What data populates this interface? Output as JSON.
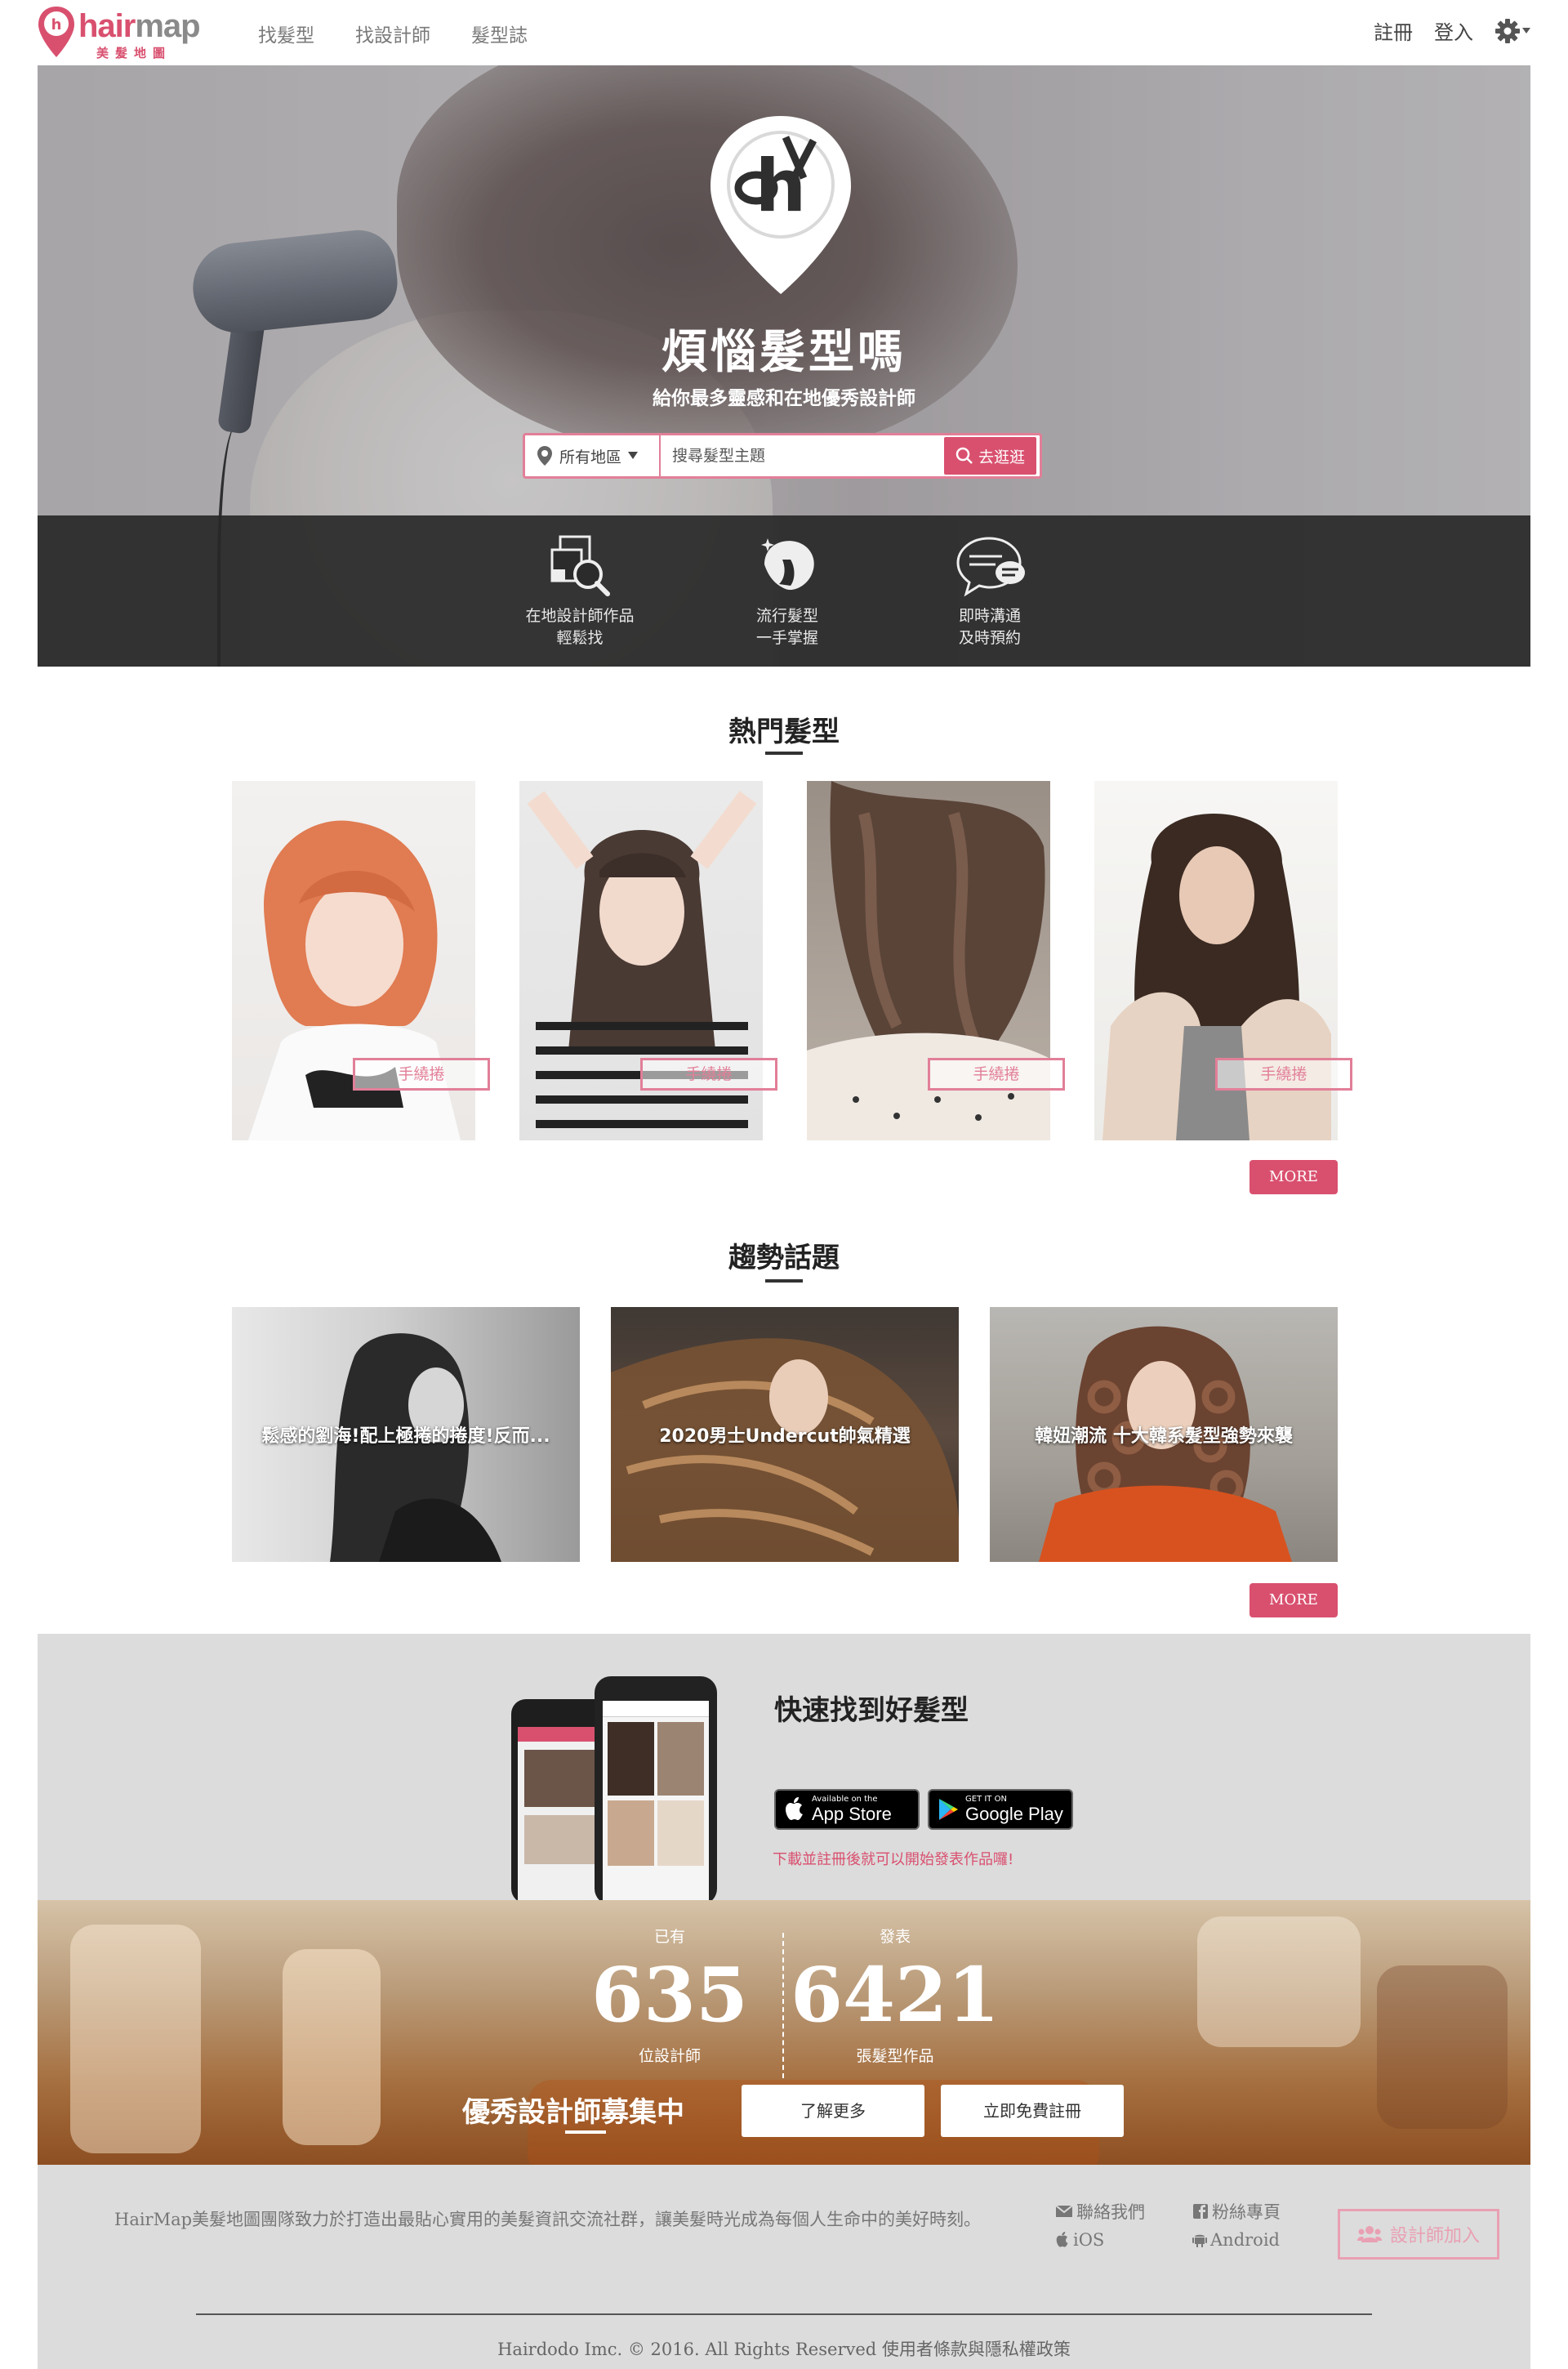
{
  "brand": {
    "name_part1": "hair",
    "name_part2": "map",
    "subtitle": "美髮地圖",
    "color": "#d9506f"
  },
  "nav": {
    "links": [
      "找髮型",
      "找設計師",
      "髮型誌"
    ],
    "register": "註冊",
    "login": "登入",
    "settings_icon": "gear-icon"
  },
  "hero": {
    "title": "煩惱髮型嗎",
    "subtitle": "給你最多靈感和在地優秀設計師",
    "search": {
      "region_label": "所有地區",
      "placeholder": "搜尋髮型主題",
      "button": "去逛逛"
    },
    "features": [
      {
        "icon": "search-works-icon",
        "line1": "在地設計師作品",
        "line2": "輕鬆找"
      },
      {
        "icon": "hairstyle-head-icon",
        "line1": "流行髮型",
        "line2": "一手掌握"
      },
      {
        "icon": "chat-bubble-icon",
        "line1": "即時溝通",
        "line2": "及時預約"
      }
    ]
  },
  "hot_styles": {
    "title": "熱門髮型",
    "items": [
      {
        "tag": "手繞捲"
      },
      {
        "tag": "手繞捲"
      },
      {
        "tag": "手繞捲"
      },
      {
        "tag": "手繞捲"
      }
    ],
    "more": "MORE"
  },
  "topics": {
    "title": "趨勢話題",
    "items": [
      {
        "title": "鬆感的劉海!配上極捲的捲度!反而..."
      },
      {
        "title": "2020男士Undercut帥氣精選"
      },
      {
        "title": "韓妞潮流 十大韓系髮型強勢來襲"
      }
    ],
    "more": "MORE"
  },
  "app": {
    "title": "快速找到好髮型",
    "appstore_small": "Available on the",
    "appstore_big": "App Store",
    "googleplay_small": "GET IT ON",
    "googleplay_big": "Google Play",
    "note": "下載並註冊後就可以開始發表作品囉!"
  },
  "stats": {
    "designers_prefix": "已有",
    "designers_count": "635",
    "designers_suffix": "位設計師",
    "works_prefix": "發表",
    "works_count": "6421",
    "works_suffix": "張髮型作品",
    "recruit": "優秀設計師募集中",
    "learn_more": "了解更多",
    "register_free": "立即免費註冊"
  },
  "footer": {
    "about": "HairMap美髮地圖團隊致力於打造出最貼心實用的美髮資訊交流社群，讓美髮時光成為每個人生命中的美好時刻。",
    "contact": "聯絡我們",
    "fanpage": "粉絲專頁",
    "ios": "iOS",
    "android": "Android",
    "join": "設計師加入",
    "copyright": "Hairdodo Imc. © 2016. All Rights Reserved 使用者條款與隱私權政策"
  }
}
